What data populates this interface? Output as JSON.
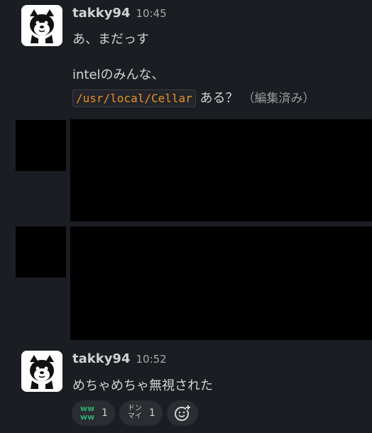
{
  "messages": [
    {
      "username": "takky94",
      "time": "10:45",
      "lines": {
        "line1": "あ、まだっす",
        "line2": "intelのみんな、",
        "code": "/usr/local/Cellar",
        "after_code": "ある？",
        "edited": "（編集済み）"
      }
    },
    {
      "username": "takky94",
      "time": "10:52",
      "lines": {
        "line1": "めちゃめちゃ無視された"
      }
    }
  ],
  "reactions": [
    {
      "emoji": "ww-icon",
      "glyph_top": "ww",
      "glyph_bottom": "ww",
      "count": "1"
    },
    {
      "emoji": "don-mai-icon",
      "glyph_top": "ドン",
      "glyph_bottom": "マイ",
      "count": "1"
    }
  ],
  "colors": {
    "background": "#1a1d21",
    "text": "#d1d2d3",
    "code": "#e8912d",
    "reaction_bg": "#2a2d31"
  }
}
